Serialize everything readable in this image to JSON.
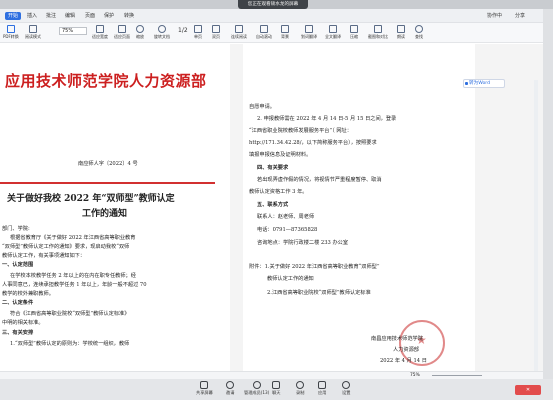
{
  "banner": {
    "label": "您正在观看硕水龙的屏幕"
  },
  "menubar": {
    "start": "开始",
    "items": [
      "插入",
      "批注",
      "编辑",
      "页面",
      "保护",
      "转换"
    ],
    "right": [
      "协作中",
      "分享"
    ]
  },
  "ribbon": {
    "zoom": "75%",
    "page": "1/2",
    "buttons": [
      "PDF转换",
      "阅读模式",
      "适应宽度",
      "适应页面",
      "缩放",
      "旋转文档",
      "单页",
      "双页",
      "连续阅读",
      "自动滚动",
      "背景",
      "划词翻译",
      "全文翻译",
      "压缩",
      "截图和对比",
      "朗读",
      "查找"
    ]
  },
  "to_word": "转为Word",
  "left_page": {
    "title": "应用技术师范学院人力资源部",
    "doc_no": "南应师人字〔2022〕4 号",
    "subject_1": "关于做好我校 2022 年“双师型”教师认定",
    "subject_2": "工作的通知",
    "greeting": "部门、学院:",
    "p1": "根据省教育厅《关于做好 2022 年江西省高等职业教育",
    "p2": "“双师型”教师认定工作的通知》要求，现启动我校“双师",
    "p3": "教师认定工作，有关事项通知如下：",
    "h1": "一、认定范围",
    "p4": "在学校本校教学任务 2 年以上的在内在职专任教师；经",
    "p5": "人事同意已，连续承担教学任务 1 年以上，年龄一般不超过 70",
    "p6": "教学的校外兼职教师。",
    "h2": "二、认定条件",
    "p7": "符合《江西省高等职业院校“双师型”教师认定标准》",
    "p8": "中明的相关标准。",
    "h3": "三、有关安排",
    "p9": "1.“双师型”教师认定的原则为：学校统一组织，教师"
  },
  "right_page": {
    "r1": "自愿申请。",
    "r2": "2. 申报教师需在 2022 年 4 月 14 日-5 月 15 日之间，登录",
    "r3": "“江西省职业院校教师发展服务平台”（ 网址：",
    "r4": "http://171.34.42.28/，以下简称服务平台），按照要求",
    "r5": "填报申报信息及证明材料。",
    "h4": "四、有关要求",
    "r6": "若出现弄虚作假的情况，将视情节严重程度暂停、取消",
    "r7": "教师认定资格工作 3 年。",
    "h5": "五、联系方式",
    "r8": "联系人：赵老师、周老师",
    "r9": "电话：0791—87365828",
    "r10": "咨询地点：学院行政楼二楼 233 办公室",
    "att1": "附件：1.关于做好 2022 年江西省高等职业教育“双师型”",
    "att2": "教师认定工作的通知",
    "att3": "2.江西省高等职业院校“双师型”教师认定标准",
    "sign1": "南昌应用技术师范学院",
    "sign2": "人力资源部",
    "sign_date": "2022 年 4 月 14 日"
  },
  "statusbar": {
    "zoom": "75%"
  },
  "meeting": {
    "buttons": [
      "共享屏幕",
      "邀请",
      "管理成员(13)",
      "聊天",
      "录制",
      "应用",
      "设置"
    ]
  }
}
